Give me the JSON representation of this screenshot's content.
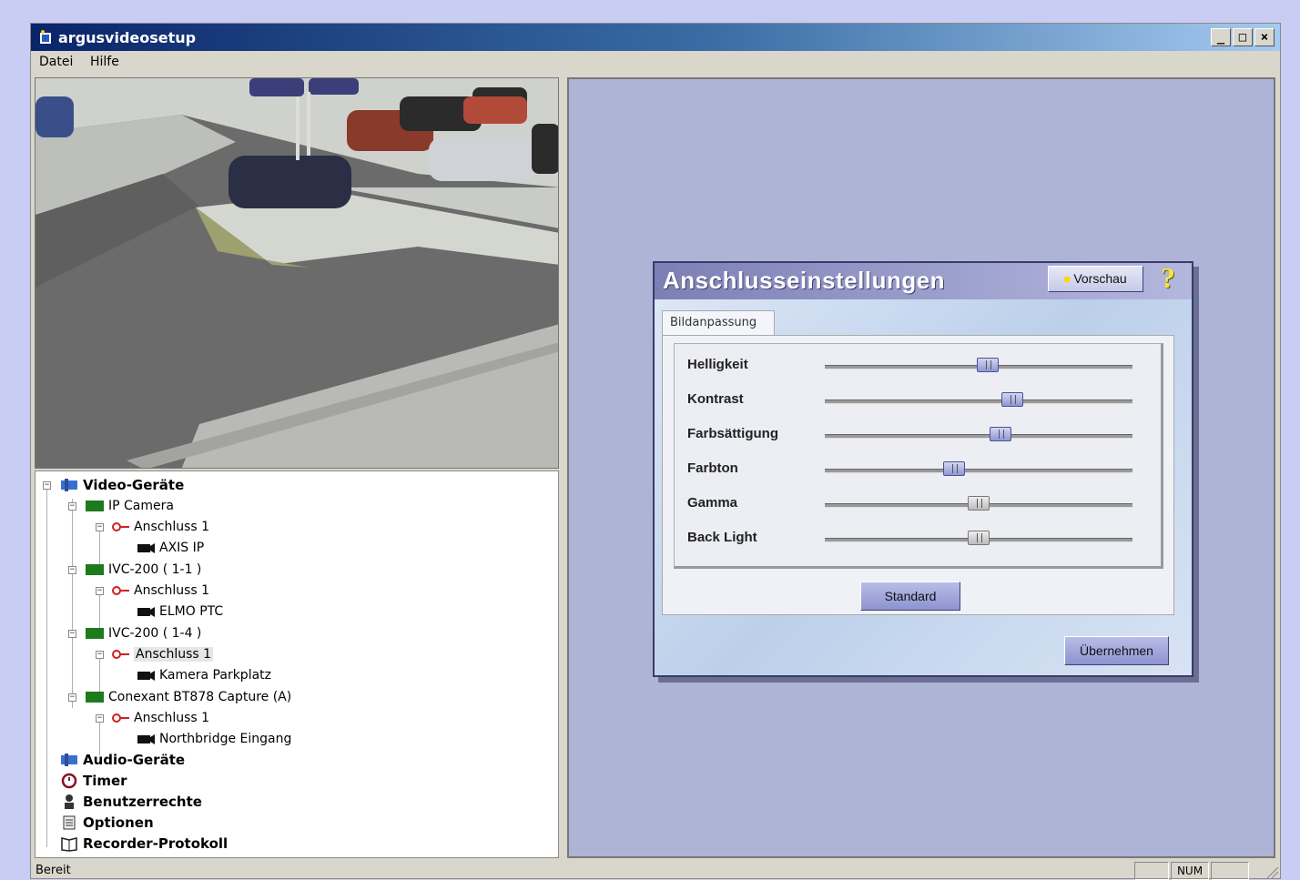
{
  "window": {
    "title": "argusvideosetup",
    "controls": [
      "_",
      "□",
      "×"
    ]
  },
  "menu": {
    "file": "Datei",
    "help": "Hilfe"
  },
  "tree": {
    "video_devices": "Video-Geräte",
    "ip_camera": "IP Camera",
    "ip_port": "Anschluss 1",
    "ip_cam": "AXIS IP",
    "ivc1": "IVC-200 ( 1-1 )",
    "ivc1_port": "Anschluss 1",
    "ivc1_cam": "ELMO PTC",
    "ivc2": "IVC-200 ( 1-4 )",
    "ivc2_port": "Anschluss 1",
    "ivc2_cam": "Kamera Parkplatz",
    "conexant": "Conexant BT878 Capture (A)",
    "conexant_port": "Anschluss 1",
    "conexant_cam": "Northbridge Eingang",
    "audio_devices": "Audio-Geräte",
    "timer": "Timer",
    "user_rights": "Benutzerrechte",
    "options": "Optionen",
    "recorder_log": "Recorder-Protokoll"
  },
  "dialog": {
    "title": "Anschlusseinstellungen",
    "preview_label": "Vorschau",
    "help": "?",
    "tab": "Bildanpassung",
    "sliders": [
      {
        "label": "Helligkeit",
        "value": 0.53
      },
      {
        "label": "Kontrast",
        "value": 0.61
      },
      {
        "label": "Farbsättigung",
        "value": 0.57
      },
      {
        "label": "Farbton",
        "value": 0.42
      },
      {
        "label": "Gamma",
        "value": 0.5
      },
      {
        "label": "Back Light",
        "value": 0.5
      }
    ],
    "standard_label": "Standard",
    "apply_label": "Übernehmen"
  },
  "status": {
    "text": "Bereit",
    "num": "NUM"
  }
}
